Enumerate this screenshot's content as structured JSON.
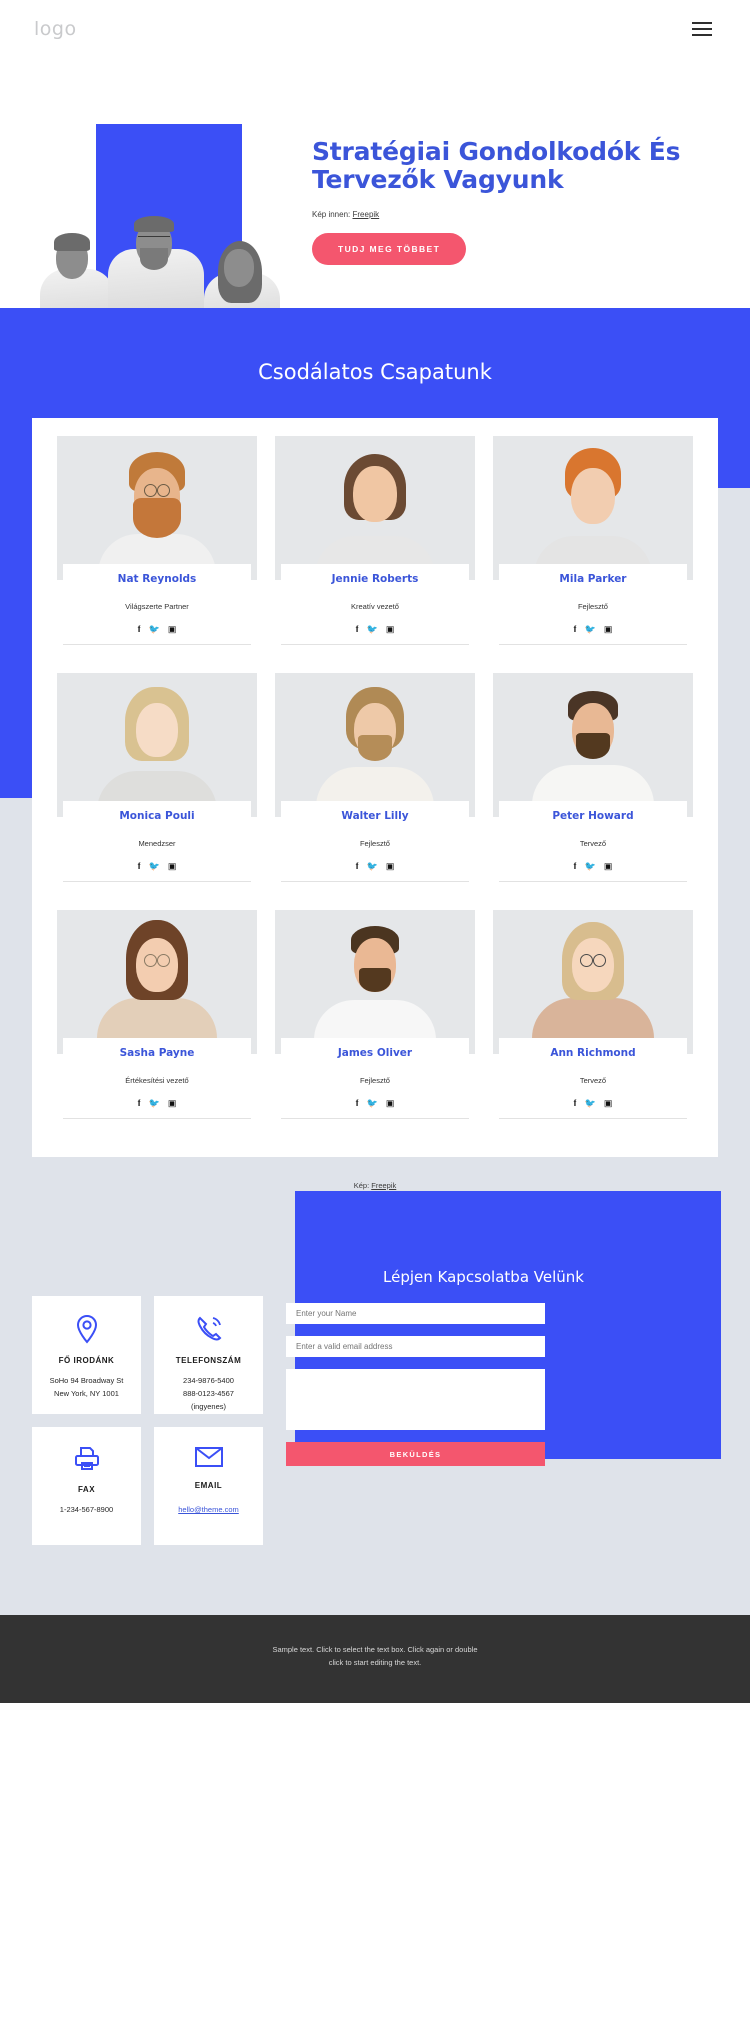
{
  "header": {
    "logo": "logo",
    "menu_icon": "hamburger-icon"
  },
  "hero": {
    "title": "Stratégiai Gondolkodók És Tervezők Vagyunk",
    "credit_prefix": "Kép innen:",
    "credit_link": "Freepik",
    "cta_label": "TUDJ MEG TÖBBET",
    "accent_blue": "#3b4ff6",
    "title_blue": "#3b55d9",
    "cta_pink": "#f4566e"
  },
  "team": {
    "heading": "Csodálatos Csapatunk",
    "credit_prefix": "Kép:",
    "credit_link": "Freepik",
    "social": [
      "f",
      "twitter",
      "instagram"
    ],
    "members": [
      {
        "name": "Nat Reynolds",
        "role": "Világszerte Partner"
      },
      {
        "name": "Jennie Roberts",
        "role": "Kreatív vezető"
      },
      {
        "name": "Mila Parker",
        "role": "Fejlesztő"
      },
      {
        "name": "Monica Pouli",
        "role": "Menedzser"
      },
      {
        "name": "Walter Lilly",
        "role": "Fejlesztő"
      },
      {
        "name": "Peter Howard",
        "role": "Tervező"
      },
      {
        "name": "Sasha Payne",
        "role": "Értékesítési vezető"
      },
      {
        "name": "James Oliver",
        "role": "Fejlesztő"
      },
      {
        "name": "Ann Richmond",
        "role": "Tervező"
      }
    ]
  },
  "contact": {
    "form_title": "Lépjen Kapcsolatba Velünk",
    "name_placeholder": "Enter your Name",
    "email_placeholder": "Enter a valid email address",
    "message_placeholder": "",
    "submit_label": "BEKÜLDÉS",
    "cards": [
      {
        "icon": "location-pin-icon",
        "title": "FŐ IRODÁNK",
        "lines": [
          "SoHo 94 Broadway St",
          "New York, NY 1001"
        ],
        "link": ""
      },
      {
        "icon": "phone-icon",
        "title": "TELEFONSZÁM",
        "lines": [
          "234-9876-5400",
          "888-0123-4567",
          "(ingyenes)"
        ],
        "link": ""
      },
      {
        "icon": "printer-icon",
        "title": "FAX",
        "lines": [
          "1-234-567-8900"
        ],
        "link": ""
      },
      {
        "icon": "envelope-icon",
        "title": "EMAIL",
        "lines": [],
        "link": "hello@theme.com"
      }
    ]
  },
  "footer": {
    "line1": "Sample text. Click to select the text box. Click again or double",
    "line2": "click to start editing the text."
  }
}
